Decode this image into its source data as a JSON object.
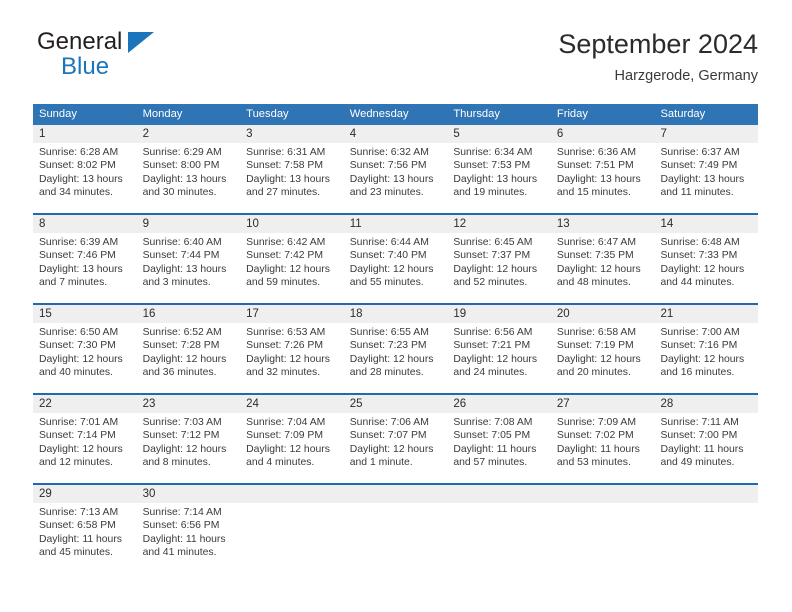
{
  "brand": {
    "name_top": "General",
    "name_bottom": "Blue",
    "triangle_color": "#1b75bb",
    "top_text_color": "#231f20"
  },
  "header": {
    "title": "September 2024",
    "subtitle": "Harzgerode, Germany"
  },
  "theme": {
    "header_bg": "#2f74b5",
    "header_text": "#ffffff",
    "daynum_band_bg": "#efefef",
    "week_divider": "#1f6ab0",
    "body_text": "#3b3b3b"
  },
  "weekdays": [
    "Sunday",
    "Monday",
    "Tuesday",
    "Wednesday",
    "Thursday",
    "Friday",
    "Saturday"
  ],
  "weeks": [
    {
      "days": [
        {
          "num": "1",
          "sunrise": "Sunrise: 6:28 AM",
          "sunset": "Sunset: 8:02 PM",
          "daylight1": "Daylight: 13 hours",
          "daylight2": "and 34 minutes."
        },
        {
          "num": "2",
          "sunrise": "Sunrise: 6:29 AM",
          "sunset": "Sunset: 8:00 PM",
          "daylight1": "Daylight: 13 hours",
          "daylight2": "and 30 minutes."
        },
        {
          "num": "3",
          "sunrise": "Sunrise: 6:31 AM",
          "sunset": "Sunset: 7:58 PM",
          "daylight1": "Daylight: 13 hours",
          "daylight2": "and 27 minutes."
        },
        {
          "num": "4",
          "sunrise": "Sunrise: 6:32 AM",
          "sunset": "Sunset: 7:56 PM",
          "daylight1": "Daylight: 13 hours",
          "daylight2": "and 23 minutes."
        },
        {
          "num": "5",
          "sunrise": "Sunrise: 6:34 AM",
          "sunset": "Sunset: 7:53 PM",
          "daylight1": "Daylight: 13 hours",
          "daylight2": "and 19 minutes."
        },
        {
          "num": "6",
          "sunrise": "Sunrise: 6:36 AM",
          "sunset": "Sunset: 7:51 PM",
          "daylight1": "Daylight: 13 hours",
          "daylight2": "and 15 minutes."
        },
        {
          "num": "7",
          "sunrise": "Sunrise: 6:37 AM",
          "sunset": "Sunset: 7:49 PM",
          "daylight1": "Daylight: 13 hours",
          "daylight2": "and 11 minutes."
        }
      ]
    },
    {
      "days": [
        {
          "num": "8",
          "sunrise": "Sunrise: 6:39 AM",
          "sunset": "Sunset: 7:46 PM",
          "daylight1": "Daylight: 13 hours",
          "daylight2": "and 7 minutes."
        },
        {
          "num": "9",
          "sunrise": "Sunrise: 6:40 AM",
          "sunset": "Sunset: 7:44 PM",
          "daylight1": "Daylight: 13 hours",
          "daylight2": "and 3 minutes."
        },
        {
          "num": "10",
          "sunrise": "Sunrise: 6:42 AM",
          "sunset": "Sunset: 7:42 PM",
          "daylight1": "Daylight: 12 hours",
          "daylight2": "and 59 minutes."
        },
        {
          "num": "11",
          "sunrise": "Sunrise: 6:44 AM",
          "sunset": "Sunset: 7:40 PM",
          "daylight1": "Daylight: 12 hours",
          "daylight2": "and 55 minutes."
        },
        {
          "num": "12",
          "sunrise": "Sunrise: 6:45 AM",
          "sunset": "Sunset: 7:37 PM",
          "daylight1": "Daylight: 12 hours",
          "daylight2": "and 52 minutes."
        },
        {
          "num": "13",
          "sunrise": "Sunrise: 6:47 AM",
          "sunset": "Sunset: 7:35 PM",
          "daylight1": "Daylight: 12 hours",
          "daylight2": "and 48 minutes."
        },
        {
          "num": "14",
          "sunrise": "Sunrise: 6:48 AM",
          "sunset": "Sunset: 7:33 PM",
          "daylight1": "Daylight: 12 hours",
          "daylight2": "and 44 minutes."
        }
      ]
    },
    {
      "days": [
        {
          "num": "15",
          "sunrise": "Sunrise: 6:50 AM",
          "sunset": "Sunset: 7:30 PM",
          "daylight1": "Daylight: 12 hours",
          "daylight2": "and 40 minutes."
        },
        {
          "num": "16",
          "sunrise": "Sunrise: 6:52 AM",
          "sunset": "Sunset: 7:28 PM",
          "daylight1": "Daylight: 12 hours",
          "daylight2": "and 36 minutes."
        },
        {
          "num": "17",
          "sunrise": "Sunrise: 6:53 AM",
          "sunset": "Sunset: 7:26 PM",
          "daylight1": "Daylight: 12 hours",
          "daylight2": "and 32 minutes."
        },
        {
          "num": "18",
          "sunrise": "Sunrise: 6:55 AM",
          "sunset": "Sunset: 7:23 PM",
          "daylight1": "Daylight: 12 hours",
          "daylight2": "and 28 minutes."
        },
        {
          "num": "19",
          "sunrise": "Sunrise: 6:56 AM",
          "sunset": "Sunset: 7:21 PM",
          "daylight1": "Daylight: 12 hours",
          "daylight2": "and 24 minutes."
        },
        {
          "num": "20",
          "sunrise": "Sunrise: 6:58 AM",
          "sunset": "Sunset: 7:19 PM",
          "daylight1": "Daylight: 12 hours",
          "daylight2": "and 20 minutes."
        },
        {
          "num": "21",
          "sunrise": "Sunrise: 7:00 AM",
          "sunset": "Sunset: 7:16 PM",
          "daylight1": "Daylight: 12 hours",
          "daylight2": "and 16 minutes."
        }
      ]
    },
    {
      "days": [
        {
          "num": "22",
          "sunrise": "Sunrise: 7:01 AM",
          "sunset": "Sunset: 7:14 PM",
          "daylight1": "Daylight: 12 hours",
          "daylight2": "and 12 minutes."
        },
        {
          "num": "23",
          "sunrise": "Sunrise: 7:03 AM",
          "sunset": "Sunset: 7:12 PM",
          "daylight1": "Daylight: 12 hours",
          "daylight2": "and 8 minutes."
        },
        {
          "num": "24",
          "sunrise": "Sunrise: 7:04 AM",
          "sunset": "Sunset: 7:09 PM",
          "daylight1": "Daylight: 12 hours",
          "daylight2": "and 4 minutes."
        },
        {
          "num": "25",
          "sunrise": "Sunrise: 7:06 AM",
          "sunset": "Sunset: 7:07 PM",
          "daylight1": "Daylight: 12 hours",
          "daylight2": "and 1 minute."
        },
        {
          "num": "26",
          "sunrise": "Sunrise: 7:08 AM",
          "sunset": "Sunset: 7:05 PM",
          "daylight1": "Daylight: 11 hours",
          "daylight2": "and 57 minutes."
        },
        {
          "num": "27",
          "sunrise": "Sunrise: 7:09 AM",
          "sunset": "Sunset: 7:02 PM",
          "daylight1": "Daylight: 11 hours",
          "daylight2": "and 53 minutes."
        },
        {
          "num": "28",
          "sunrise": "Sunrise: 7:11 AM",
          "sunset": "Sunset: 7:00 PM",
          "daylight1": "Daylight: 11 hours",
          "daylight2": "and 49 minutes."
        }
      ]
    },
    {
      "days": [
        {
          "num": "29",
          "sunrise": "Sunrise: 7:13 AM",
          "sunset": "Sunset: 6:58 PM",
          "daylight1": "Daylight: 11 hours",
          "daylight2": "and 45 minutes."
        },
        {
          "num": "30",
          "sunrise": "Sunrise: 7:14 AM",
          "sunset": "Sunset: 6:56 PM",
          "daylight1": "Daylight: 11 hours",
          "daylight2": "and 41 minutes."
        },
        {
          "num": "",
          "sunrise": "",
          "sunset": "",
          "daylight1": "",
          "daylight2": ""
        },
        {
          "num": "",
          "sunrise": "",
          "sunset": "",
          "daylight1": "",
          "daylight2": ""
        },
        {
          "num": "",
          "sunrise": "",
          "sunset": "",
          "daylight1": "",
          "daylight2": ""
        },
        {
          "num": "",
          "sunrise": "",
          "sunset": "",
          "daylight1": "",
          "daylight2": ""
        },
        {
          "num": "",
          "sunrise": "",
          "sunset": "",
          "daylight1": "",
          "daylight2": ""
        }
      ]
    }
  ]
}
